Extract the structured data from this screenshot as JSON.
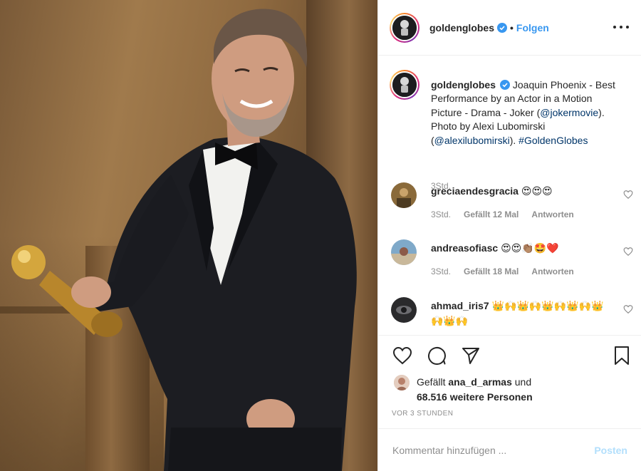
{
  "header": {
    "username": "goldenglobes",
    "separator": "•",
    "follow_label": "Folgen",
    "more_icon": "more-horizontal-icon"
  },
  "caption": {
    "username": "goldenglobes",
    "text_part1": "Joaquin Phoenix - Best Performance by an Actor in a Motion Picture - Drama - Joker (",
    "mention1": "@jokermovie",
    "text_part2": "). Photo by Alexi Lubomirski (",
    "mention2": "@alexilubomirski",
    "text_part3": "). ",
    "hashtag": "#GoldenGlobes",
    "time": "3Std."
  },
  "comments": [
    {
      "username": "greciaendesgracia",
      "text": "😍😍😍",
      "time": "3Std.",
      "likes": "Gefällt 12 Mal",
      "reply": "Antworten"
    },
    {
      "username": "andreasofiasc",
      "text": "😍😍👏🏽🤩❤️",
      "time": "3Std.",
      "likes": "Gefällt 18 Mal",
      "reply": "Antworten"
    },
    {
      "username": "ahmad_iris7",
      "text": "👑🙌👑🙌👑🙌👑🙌👑🙌👑🙌"
    }
  ],
  "actions": {
    "like_icon": "heart-icon",
    "comment_icon": "comment-icon",
    "share_icon": "paper-plane-icon",
    "save_icon": "bookmark-icon"
  },
  "likes": {
    "prefix": "Gefällt ",
    "user": "ana_d_armas",
    "suffix": " und",
    "count_line": "68.516 weitere Personen"
  },
  "timestamp": "VOR 3 STUNDEN",
  "add_comment": {
    "placeholder": "Kommentar hinzufügen ...",
    "post_label": "Posten"
  },
  "colors": {
    "link": "#3897f0",
    "mention": "#003569",
    "muted": "#8e8e8e",
    "post_disabled": "#b2dffc",
    "border": "#efefef"
  }
}
